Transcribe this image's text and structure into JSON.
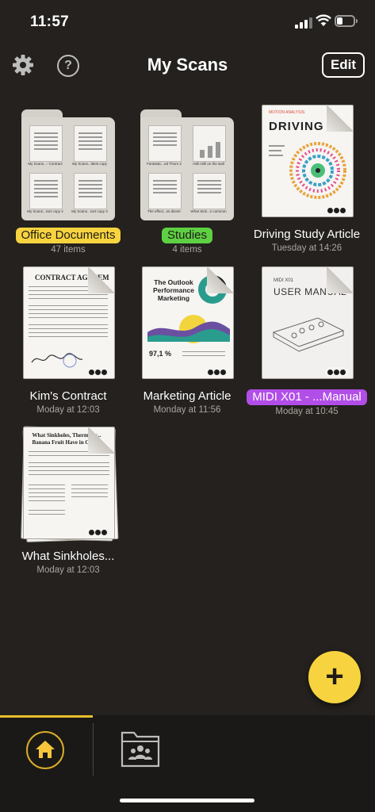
{
  "status": {
    "time": "11:57"
  },
  "nav": {
    "title": "My Scans",
    "edit_label": "Edit",
    "help_glyph": "?"
  },
  "colors": {
    "background": "#24211e",
    "yellow_tag": "#f7d43f",
    "green_tag": "#5ed043",
    "purple_tag": "#b24ee8",
    "accent": "#f7d43f"
  },
  "items": [
    {
      "name": "Office Documents",
      "sub": "47 items",
      "type": "folder",
      "tag_color": "#f7d43f",
      "minis": [
        "My Scans...- Contract",
        "My Scans...ittest copy",
        "My Scans...ract copy 2",
        "My Scans...ract copy 3"
      ]
    },
    {
      "name": "Studies",
      "sub": "4 items",
      "type": "folder",
      "tag_color": "#5ed043",
      "minis": [
        "Fantastic...ed Thorn 2",
        "milli milli on the wall",
        "The effect...ss dinner",
        "What Sink...n common"
      ]
    },
    {
      "name": "Driving Study Article",
      "sub": "Tuesday at 14:26",
      "type": "document",
      "doc_title": "DRIVING",
      "doc_top": "MOTION ANALYSIS"
    },
    {
      "name": "Kim's Contract",
      "sub": "Moday at 12:03",
      "type": "document",
      "doc_title": "CONTRACT AGREEM"
    },
    {
      "name": "Marketing Article",
      "sub": "Monday at 11:56",
      "type": "document",
      "doc_title": "The Outlook Performance Marketing",
      "doc_stat": "97,1 %"
    },
    {
      "name": "MIDI X01 - ...Manual",
      "sub": "Moday at 10:45",
      "type": "document",
      "tag_color": "#b24ee8",
      "doc_title": "USER MANUAL",
      "doc_top": "MIDI X01"
    },
    {
      "name": "What Sinkholes...",
      "sub": "Moday at 12:03",
      "type": "document",
      "doc_title": "What Sinkholes, Thermody... Banana Fruit Have in Comm"
    }
  ],
  "fab": {
    "label": "+"
  },
  "tabbar": {
    "home": "home-icon",
    "shared": "shared-folder-icon"
  }
}
